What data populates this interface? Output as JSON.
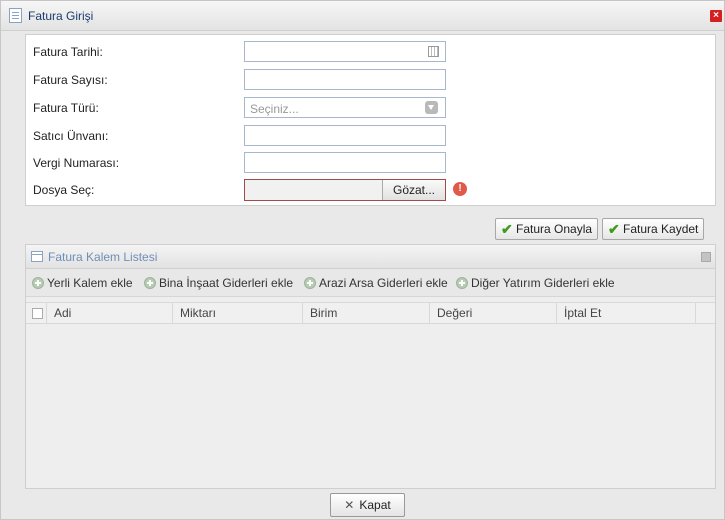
{
  "window": {
    "title": "Fatura Girişi"
  },
  "form": {
    "labels": {
      "date": "Fatura Tarihi:",
      "number": "Fatura Sayısı:",
      "type": "Fatura Türü:",
      "seller": "Satıcı Ünvanı:",
      "tax_no": "Vergi Numarası:",
      "file": "Dosya Seç:"
    },
    "type_placeholder": "Seçiniz...",
    "browse_label": "Gözat...",
    "warning_mark": "!",
    "confirm_label": "Fatura Onayla",
    "save_label": "Fatura Kaydet"
  },
  "list": {
    "title": "Fatura Kalem Listesi",
    "toolbar": [
      "Yerli Kalem ekle",
      "Bina İnşaat Giderleri ekle",
      "Arazi Arsa Giderleri ekle",
      "Diğer Yatırım Giderleri ekle"
    ],
    "columns": [
      "Adi",
      "Miktarı",
      "Birim",
      "Değeri",
      "İptal Et"
    ]
  },
  "footer": {
    "close_label": "Kapat"
  },
  "colors": {
    "close_button": "#d62020",
    "check": "#3f9a1e",
    "warning": "#e05a4a"
  }
}
